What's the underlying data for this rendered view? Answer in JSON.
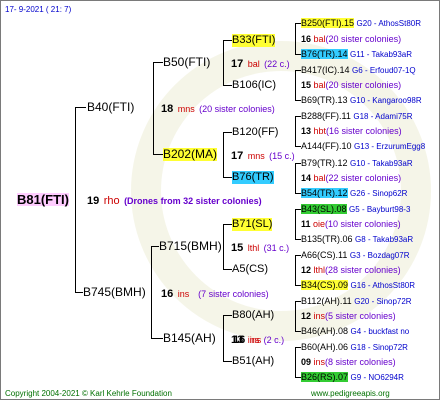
{
  "header": "17-  9-2021 ( 21:  7)",
  "footer": {
    "copyright": "Copyright 2004-2021 © Karl Kehrle Foundation",
    "url": "www.pedigreeapis.org"
  },
  "root": {
    "label": "B81(FTI)",
    "num": "19",
    "rl": "rho",
    "note": "(Drones from 32 sister colonies)"
  },
  "gen1": [
    {
      "label": "B40(FTI)"
    },
    {
      "label": "B745(BMH)",
      "num": "16",
      "rl": "ins",
      "sis": "(7 sister colonies)"
    }
  ],
  "gen2": [
    {
      "label": "B50(FTI)"
    },
    {
      "label": "B202(MA)",
      "num": "18",
      "rl": "mns",
      "sis": "(20 sister colonies)"
    },
    {
      "label": "B715(BMH)"
    },
    {
      "label": "B145(AH)",
      "num": "16",
      "rl": "ins"
    }
  ],
  "gen3": [
    {
      "label": "B33(FTI)",
      "num": "17",
      "rl": "bal",
      "sis": "(22 c.)"
    },
    {
      "label": "B106(IC)"
    },
    {
      "label": "B120(FF)",
      "num": "17",
      "rl": "mns",
      "sis": "(15 c.)"
    },
    {
      "label": "B76(TR)"
    },
    {
      "label": "B71(SL)",
      "num": "15",
      "rl": "lthl",
      "sis": "(31 c.)"
    },
    {
      "label": "A5(CS)"
    },
    {
      "label": "B80(AH)",
      "num": "13",
      "rl": "ins",
      "sis": "(2 c.)"
    },
    {
      "label": "B51(AH)"
    }
  ],
  "gen4": [
    {
      "label": "B250(FTI).15",
      "info": "G20 - AthosSt80R"
    },
    {
      "num": "16",
      "rl": "bal",
      "sis": "(20 sister colonies)"
    },
    {
      "label": "B76(TR).14",
      "info": "G11 - Takab93aR"
    },
    {
      "label": "B417(IC).14",
      "info": "G6 - Erfoud07-1Q"
    },
    {
      "num": "15",
      "rl": "bal",
      "sis": "(20 sister colonies)"
    },
    {
      "label": "B69(TR).13",
      "info": "G10 - Kangaroo98R"
    },
    {
      "label": "B288(FF).11",
      "info": "G18 - Adami75R"
    },
    {
      "num": "13",
      "rl": "hbt",
      "sis": "(16 sister colonies)"
    },
    {
      "label": "A144(FF).10",
      "info": "G13 - ErzurumEgg8"
    },
    {
      "label": "B79(TR).12",
      "info": "G10 - Takab93aR"
    },
    {
      "num": "14",
      "rl": "bal",
      "sis": "(22 sister colonies)"
    },
    {
      "label": "B54(TR).12",
      "info": "G26 - Sinop62R"
    },
    {
      "label": "B43(SL).08",
      "info": "G5 - Bayburt98-3"
    },
    {
      "num": "11",
      "rl": "oie",
      "sis": "(10 sister colonies)"
    },
    {
      "label": "B135(TR).06",
      "info": "G8 - Takab93aR"
    },
    {
      "label": "A66(CS).11",
      "info": "G3 - Bozdag07R"
    },
    {
      "num": "12",
      "rl": "lthl",
      "sis": "(28 sister colonies)"
    },
    {
      "label": "B34(CS).09",
      "info": "G16 - AthosSt80R"
    },
    {
      "label": "B112(AH).11",
      "info": "G20 - Sinop72R"
    },
    {
      "num": "12",
      "rl": "ins",
      "sis": "(5 sister colonies)"
    },
    {
      "label": "B46(AH).08",
      "info": "G4 - buckfast no"
    },
    {
      "label": "B60(AH).06",
      "info": "G18 - Sinop72R"
    },
    {
      "num": "09",
      "rl": "ins",
      "sis": "(8 sister colonies)"
    },
    {
      "label": "B26(RS).07",
      "info": "G9 - NO6294R"
    }
  ]
}
